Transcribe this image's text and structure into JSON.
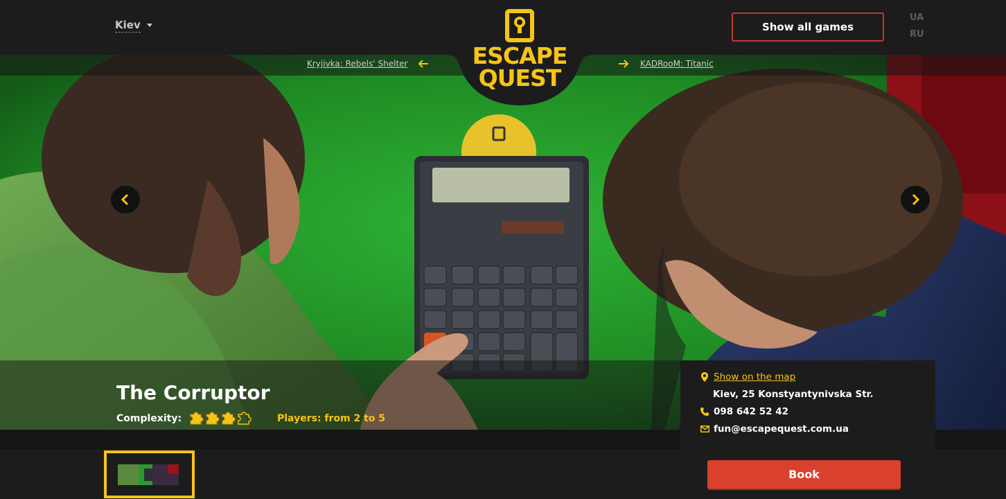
{
  "header": {
    "city": "Kiev",
    "show_all_label": "Show all games",
    "languages": [
      "UA",
      "RU"
    ]
  },
  "logo": {
    "line1": "ESCAPE",
    "line2": "QUEST"
  },
  "navigation": {
    "prev_game": "Kryjivka: Rebels' Shelter",
    "next_game": "KADRooM: Titanic"
  },
  "game": {
    "title": "The Corruptor",
    "complexity_label": "Complexity:",
    "complexity_level": 3,
    "complexity_max": 4,
    "players_label": "Players:",
    "players_value": "from 2 to 5"
  },
  "info": {
    "map_link": "Show on the map",
    "address": "Kiev, 25 Konstyantynivska Str.",
    "phone": "098 642 52 42",
    "email": "fun@escapequest.com.ua"
  },
  "book_label": "Book",
  "colors": {
    "accent": "#f6c417",
    "primary": "#d9412c",
    "bg": "#1c1c1c"
  }
}
